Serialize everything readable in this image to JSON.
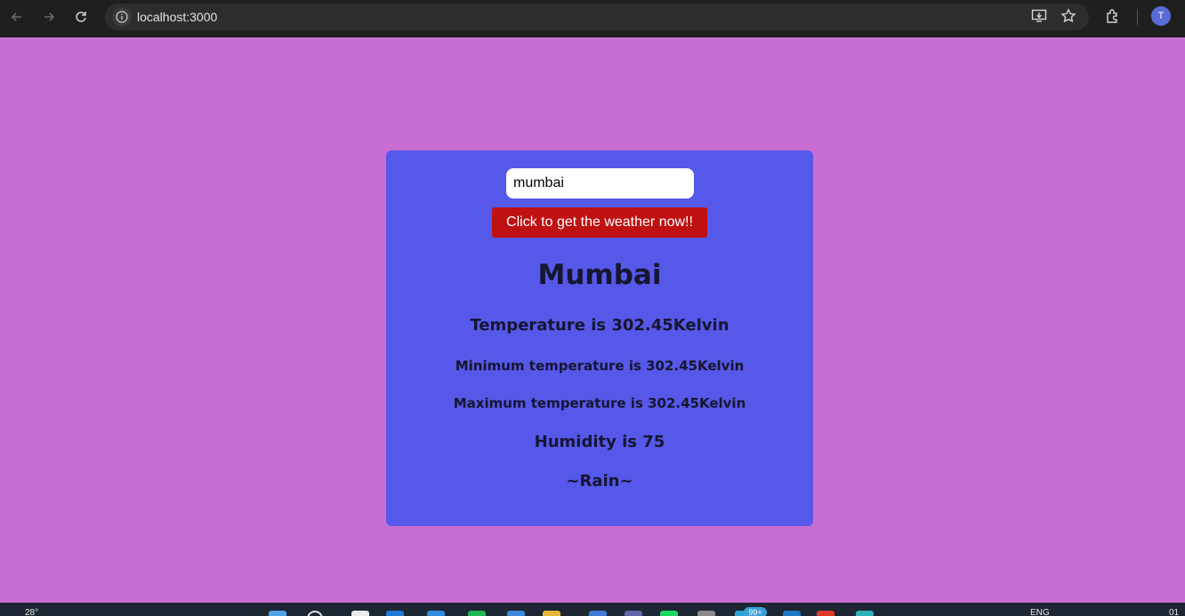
{
  "browser": {
    "url": "localhost:3000",
    "profile_initial": "T",
    "icons": [
      "back-arrow-icon",
      "forward-arrow-icon",
      "reload-icon",
      "site-info-icon",
      "install-app-icon",
      "bookmark-star-icon",
      "extensions-icon"
    ]
  },
  "form": {
    "city_value": "mumbai",
    "submit_label": "Click to get the weather now!!"
  },
  "weather": {
    "city": "Mumbai",
    "temperature": "Temperature is 302.45Kelvin",
    "min_temperature": "Minimum temperature is 302.45Kelvin",
    "max_temperature": "Maximum temperature is 302.45Kelvin",
    "humidity": "Humidity is 75",
    "description": "~Rain~"
  },
  "colors": {
    "page_background": "#c86dd1",
    "card_background": "#5558e8",
    "button_background": "#bf1111",
    "browser_chrome": "#1f1f1f"
  },
  "taskbar": {
    "weather_temp": "28°",
    "language": "ENG",
    "notification_badge": "99+",
    "clock_partial": "01"
  }
}
